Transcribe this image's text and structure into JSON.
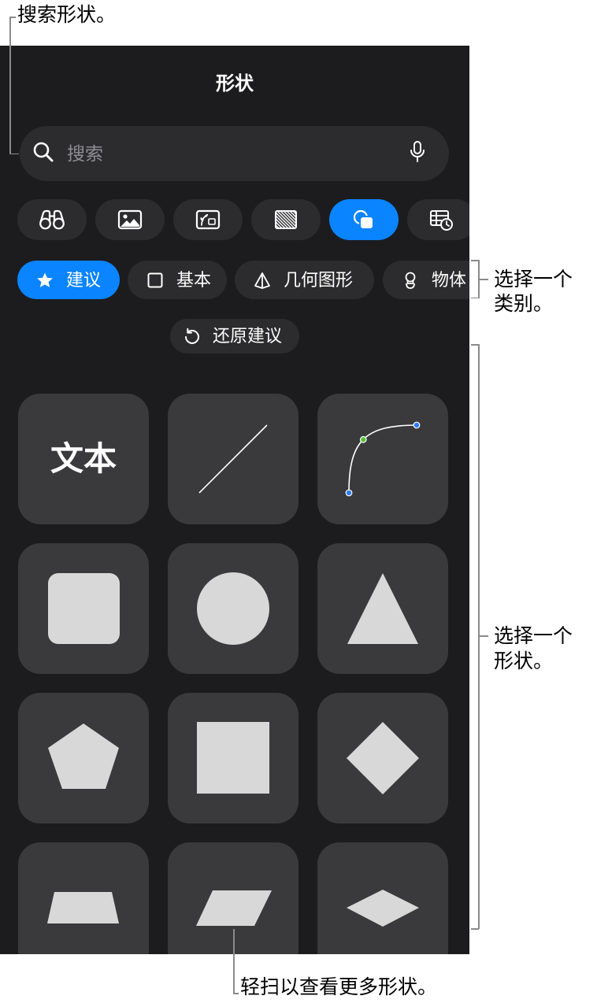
{
  "colors": {
    "page_background": "#ffffff",
    "panel_background": "#1c1c1e",
    "control_background": "#2c2c2e",
    "tile_background": "#3a3a3c",
    "accent": "#0a84ff",
    "shape_fill": "#d8d8d8",
    "text_primary": "#ffffff",
    "text_secondary": "#8e8e93",
    "callout_text": "#000000",
    "callout_line": "#8a8a8a",
    "curve_endpoint": "#2e7cf6",
    "curve_control": "#58c23c"
  },
  "callouts": {
    "search": "搜索形状。",
    "category": [
      "选择一个",
      "类别。"
    ],
    "shape": [
      "选择一个",
      "形状。"
    ],
    "swipe": "轻扫以查看更多形状。"
  },
  "panel": {
    "title": "形状",
    "search": {
      "icon": "search-icon",
      "placeholder": "搜索",
      "mic_icon": "microphone-icon"
    },
    "source_tabs": [
      {
        "icon": "binoculars-icon",
        "selected": false
      },
      {
        "icon": "photo-icon",
        "selected": false
      },
      {
        "icon": "illustration-icon",
        "selected": false
      },
      {
        "icon": "texture-icon",
        "selected": false
      },
      {
        "icon": "shapes-icon",
        "selected": true
      },
      {
        "icon": "table-chart-icon",
        "selected": false
      }
    ],
    "categories": [
      {
        "label": "建议",
        "icon": "star-icon",
        "selected": true
      },
      {
        "label": "基本",
        "icon": "square-outline-icon",
        "selected": false
      },
      {
        "label": "几何图形",
        "icon": "pyramid-icon",
        "selected": false
      },
      {
        "label": "物体",
        "icon": "lightbulb-icon",
        "selected": false
      }
    ],
    "reset": {
      "label": "还原建议",
      "icon": "undo-icon"
    },
    "shapes": [
      {
        "icon": "text-box-icon",
        "label": "文本"
      },
      {
        "icon": "line-icon"
      },
      {
        "icon": "curve-icon"
      },
      {
        "icon": "rounded-square-icon"
      },
      {
        "icon": "circle-icon"
      },
      {
        "icon": "triangle-icon"
      },
      {
        "icon": "pentagon-icon"
      },
      {
        "icon": "square-icon"
      },
      {
        "icon": "diamond-icon"
      },
      {
        "icon": "trapezoid-icon"
      },
      {
        "icon": "parallelogram-icon"
      },
      {
        "icon": "flat-diamond-icon"
      }
    ]
  }
}
